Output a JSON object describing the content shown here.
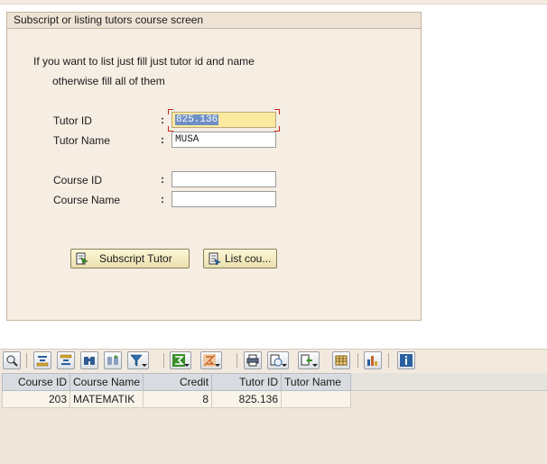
{
  "screen": {
    "group_title": "Subscript or listing tutors course screen",
    "hint_line1": "If you want to list just fill just tutor id and name",
    "hint_line2": "otherwise fill all of them"
  },
  "form": {
    "colon": ":",
    "tutor_id": {
      "label": "Tutor ID",
      "value": "825.136"
    },
    "tutor_name": {
      "label": "Tutor Name",
      "value": "MUSA"
    },
    "course_id": {
      "label": "Course ID",
      "value": ""
    },
    "course_name": {
      "label": "Course Name",
      "value": ""
    }
  },
  "buttons": {
    "subscript": "Subscript Tutor",
    "list": "List cou..."
  },
  "toolbar": {
    "icons": [
      "details-icon",
      "sort-ascending-icon",
      "sort-descending-icon",
      "find-icon",
      "find-next-icon",
      "filter-icon",
      "sum-icon",
      "subtotal-icon",
      "print-icon",
      "views-icon",
      "export-icon",
      "layout-icon",
      "graphic-icon",
      "info-icon"
    ]
  },
  "table": {
    "columns": [
      "Course ID",
      "Course Name",
      "Credit",
      "Tutor ID",
      "Tutor Name"
    ],
    "rows": [
      [
        "203",
        "MATEMATIK",
        "8",
        "825.136",
        ""
      ]
    ]
  }
}
